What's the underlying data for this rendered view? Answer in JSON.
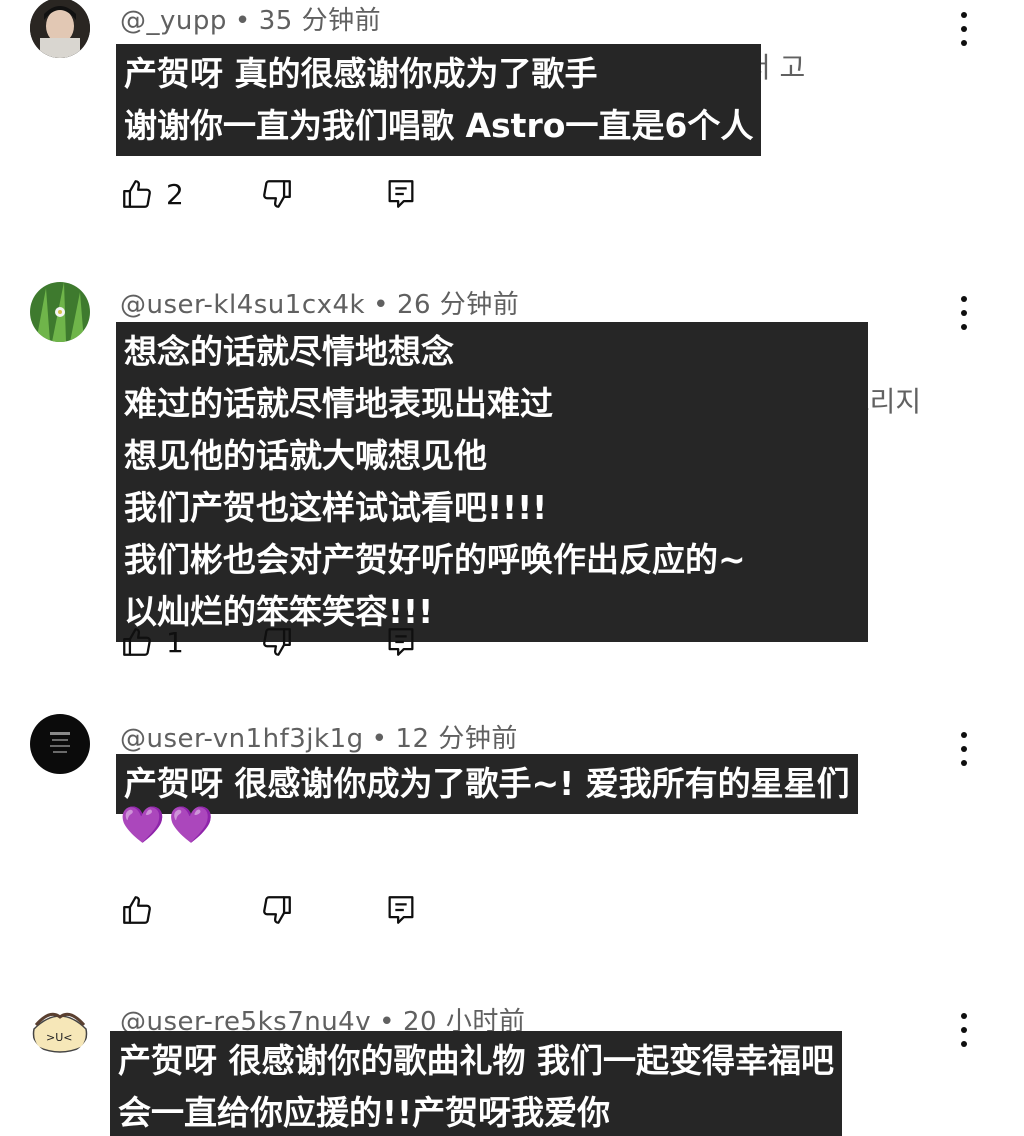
{
  "comments": [
    {
      "handle": "@_yupp",
      "time": "35 分钟前",
      "underlying": "내가 ... 노래불러줘서 고",
      "subtitle": [
        "产贺呀 真的很感谢你成为了歌手",
        "谢谢你一直为我们唱歌 Astro一直是6个人"
      ],
      "likes": "2"
    },
    {
      "handle": "@user-kl4su1cx4k",
      "time": "26 分钟前",
      "underlying": "보고프면 보고프다 소리지",
      "subtitle": [
        "想念的话就尽情地想念",
        "难过的话就尽情地表现出难过",
        "想见他的话就大喊想见他",
        "我们产贺也这样试试看吧!!!!",
        "我们彬也会对产贺好听的呼唤作出反应的~",
        "以灿烂的笨笨笑容!!!"
      ],
      "likes": "1"
    },
    {
      "handle": "@user-vn1hf3jk1g",
      "time": "12 分钟前",
      "subtitle": [
        "产贺呀 很感谢你成为了歌手~! 爱我所有的星星们"
      ],
      "hearts": "💜💜",
      "likes": ""
    },
    {
      "handle": "@user-re5ks7nu4v",
      "time": "20 小时前",
      "subtitle": [
        "产贺呀 很感谢你的歌曲礼物 我们一起变得幸福吧",
        "会一直给你应援的!!产贺呀我爱你"
      ]
    }
  ],
  "icons": {
    "like": "thumb-up-icon",
    "dislike": "thumb-down-icon",
    "reply": "reply-icon",
    "more": "more-vertical-icon"
  },
  "colors": {
    "subtitle_bg": "#262626",
    "subtitle_text": "#ffffff",
    "meta_text": "#606060"
  }
}
